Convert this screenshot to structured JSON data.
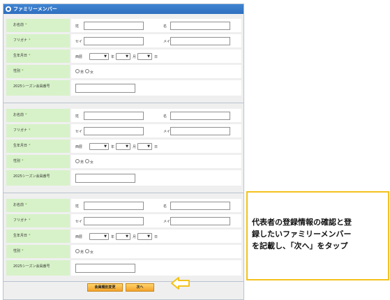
{
  "header": {
    "title": "ファミリーメンバー"
  },
  "labels": {
    "name": "お名前",
    "furigana": "フリガナ",
    "birthday": "生年月日",
    "gender": "性別",
    "membership": "2025シーズン会員番号",
    "required_mark": "*"
  },
  "fields": {
    "sei": "姓",
    "mei": "名",
    "sei_kana": "セイ",
    "mei_kana": "メイ",
    "era": "西暦",
    "year": "年",
    "month": "月",
    "day": "日",
    "male": "男",
    "female": "女"
  },
  "buttons": {
    "back": "会員種別変更",
    "next": "次へ"
  },
  "instruction": {
    "lines": [
      "代表者の登録情報の確認と登",
      "録したいファミリーメンバー",
      "を記載し、「次へ」をタップ"
    ]
  },
  "colors": {
    "header": "#2f6fbf",
    "label_bg": "#d7f2c8",
    "button": "#f3a32a",
    "highlight_border": "#f3c21c"
  }
}
